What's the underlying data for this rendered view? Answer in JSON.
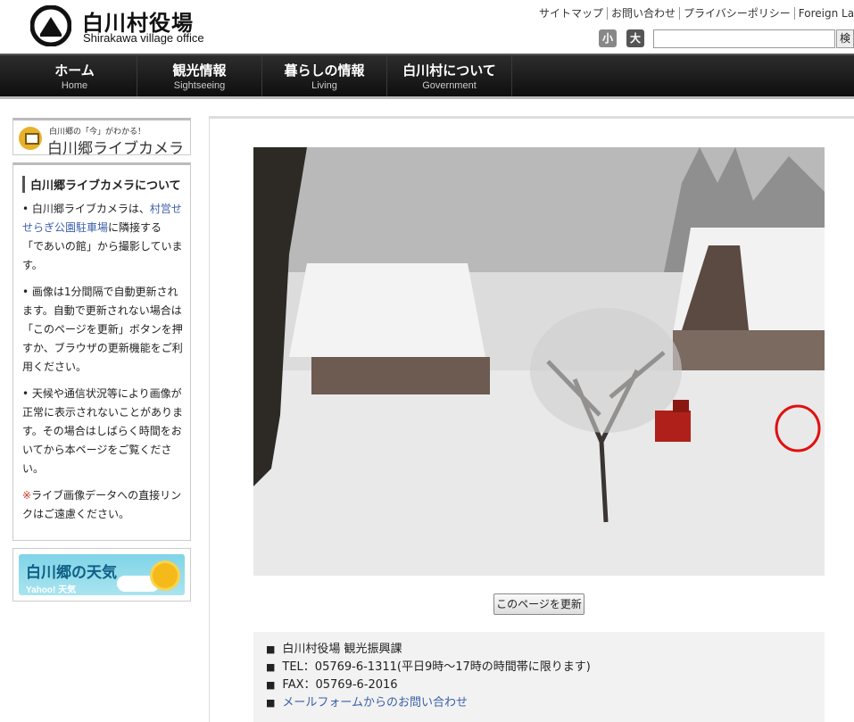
{
  "header": {
    "title_jp": "白川村役場",
    "title_en": "Shirakawa village office",
    "links": [
      "サイトマップ",
      "お問い合わせ",
      "プライバシーポリシー",
      "Foreign Language"
    ],
    "font_small": "小",
    "font_large": "大",
    "search_button": "検索",
    "search_value": ""
  },
  "nav": [
    {
      "jp": "ホーム",
      "en": "Home"
    },
    {
      "jp": "観光情報",
      "en": "Sightseeing"
    },
    {
      "jp": "暮らしの情報",
      "en": "Living"
    },
    {
      "jp": "白川村について",
      "en": "Government"
    }
  ],
  "sidebar": {
    "banner_small": "白川郷の「今」がわかる！",
    "banner_big": "白川郷ライブカメラ",
    "heading": "白川郷ライブカメラについて",
    "p1_a": "• 白川郷ライブカメラは、",
    "p1_link": "村営せせらぎ公園駐車場",
    "p1_b": "に隣接する「であいの館」から撮影しています。",
    "p2": "• 画像は1分間隔で自動更新されます。自動で更新されない場合は「このページを更新」ボタンを押すか、ブラウザの更新機能をご利用ください。",
    "p3": "• 天候や通信状況等により画像が正常に表示されないことがあります。その場合はしばらく時間をおいてから本ページをご覧ください。",
    "p4_mark": "※",
    "p4": "ライブ画像データへの直接リンクはご遠慮ください。",
    "weather_title": "白川郷の天気",
    "weather_sub": "Yahoo! 天気"
  },
  "main": {
    "refresh_button": "このページを更新",
    "contact": [
      "白川村役場 観光振興課",
      "TEL：05769-6-1311(平日9時～17時の時間帯に限ります)",
      "FAX：05769-6-2016"
    ],
    "contact_link": "メールフォームからのお問い合わせ"
  },
  "colors": {
    "link": "#3b5fa8",
    "nav": "#1a1a1a",
    "annotation": "#e01010"
  }
}
